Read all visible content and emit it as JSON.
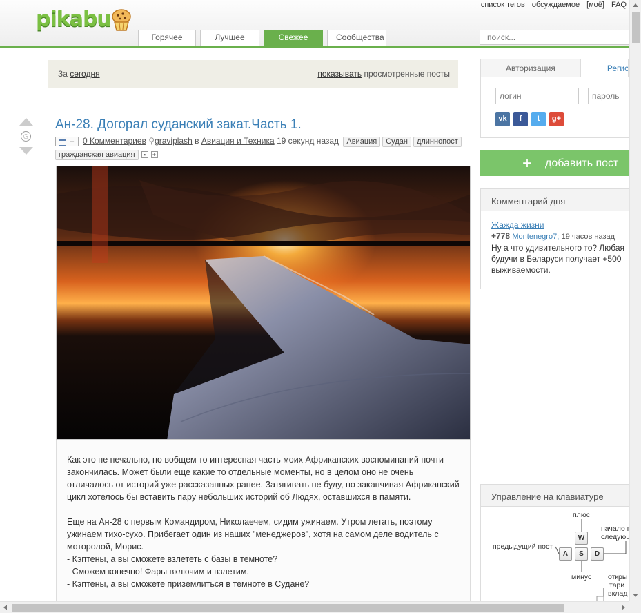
{
  "header": {
    "logo_text": "pikabu",
    "top_links": [
      "список тегов",
      "обсуждаемое",
      "[моё]",
      "FAQ"
    ],
    "tabs": [
      {
        "label": "Горячее",
        "active": false
      },
      {
        "label": "Лучшее",
        "active": false
      },
      {
        "label": "Свежее",
        "active": true
      },
      {
        "label": "Сообщества",
        "active": false
      }
    ],
    "search_placeholder": "поиск..."
  },
  "filter": {
    "prefix": "За",
    "period": "сегодня",
    "show_link": "показывать",
    "show_suffix": "просмотренные посты"
  },
  "post": {
    "title": "Ан-28. Догорал суданский закат.Часть 1.",
    "comments": "0 Комментариев",
    "author": "graviplash",
    "in_word": "в",
    "community": "Авиация и Техника",
    "time": "19 секунд назад",
    "tags": [
      "Авиация",
      "Судан",
      "длиннопост",
      "гражданская авиация"
    ],
    "paragraphs": [
      "Как это не печально, но вобщем то интересная часть моих Африканских воспоминаний почти закончилась. Может были еще какие то отдельные моменты, но в целом оно не очень отличалось от историй уже рассказанных ранее. Затягивать не буду, но заканчивая Африканский цикл хотелось бы вставить пару небольших историй об Людях, оставшихся в памяти.",
      "Еще на Ан-28 с первым Командиром, Николаечем, сидим ужинаем. Утром летать, поэтому ужинаем тихо-сухо. Прибегает один из наших \"менеджеров\", хотя на самом деле водитель с моторолой, Морис.",
      "- Кэптены, а вы сможете взлететь с базы в темноте?",
      "- Сможем конечно! Фары включим и взлетим.",
      "- Кэптены, а вы сможете приземлиться в темноте в Судане?"
    ]
  },
  "sidebar": {
    "auth": {
      "tab_login": "Авторизация",
      "tab_register": "Регистрация",
      "login_placeholder": "логин",
      "password_placeholder": "пароль",
      "socials": [
        {
          "name": "vk",
          "glyph": "vk",
          "color": "#4c75a3"
        },
        {
          "name": "facebook",
          "glyph": "f",
          "color": "#3b5998"
        },
        {
          "name": "twitter",
          "glyph": "t",
          "color": "#55acee"
        },
        {
          "name": "google-plus",
          "glyph": "g+",
          "color": "#dd4b39"
        }
      ]
    },
    "add_post": "добавить пост",
    "comment_of_day": {
      "title": "Комментарий дня",
      "post_link": "Жажда жизни",
      "rating": "+778",
      "user": "Montenegro7;",
      "time": "19 часов назад",
      "text": [
        "Ну а что удивительного то? Любая",
        "будучи в Беларуси получает +500",
        "выживаемости."
      ]
    },
    "keyboard": {
      "title": "Управление на клавиатуре",
      "labels": {
        "plus": "плюс",
        "prev_post": "предыдущий пост",
        "minus": "минус",
        "next_top": "начало п",
        "next_bottom": "следующ",
        "open1": "откры",
        "open2": "тари",
        "open3": "вклад"
      },
      "keys": [
        "W",
        "A",
        "S",
        "D"
      ]
    }
  }
}
